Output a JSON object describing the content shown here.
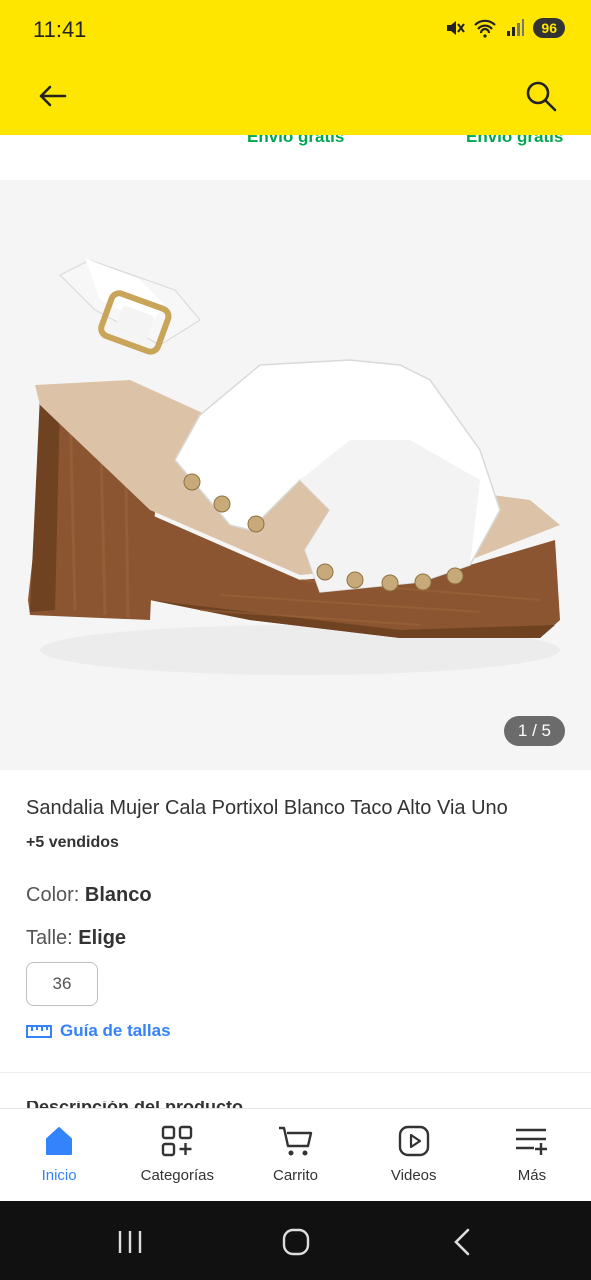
{
  "status_bar": {
    "time": "11:41",
    "battery": "96"
  },
  "header": {
    "back_icon": "arrow-left-icon",
    "search_icon": "search-icon"
  },
  "shipping_peek": [
    "Envío gratis",
    "Envío gratis"
  ],
  "gallery": {
    "counter": "1 / 5"
  },
  "product": {
    "title": "Sandalia Mujer Cala Portixol  Blanco Taco Alto Via Uno",
    "sold": "+5 vendidos",
    "color_label": "Color: ",
    "color_value": "Blanco",
    "size_label": "Talle: ",
    "size_value": "Elige",
    "size_option": "36",
    "size_guide": "Guía de tallas"
  },
  "peek": {
    "section_partial": "Descripción del producto"
  },
  "bottom_nav": [
    {
      "label": "Inicio",
      "icon": "home-icon",
      "active": true
    },
    {
      "label": "Categorías",
      "icon": "categories-icon",
      "active": false
    },
    {
      "label": "Carrito",
      "icon": "cart-icon",
      "active": false
    },
    {
      "label": "Videos",
      "icon": "video-icon",
      "active": false
    },
    {
      "label": "Más",
      "icon": "more-menu-icon",
      "active": false
    }
  ],
  "colors": {
    "header": "#ffe600",
    "accent": "#3483fa",
    "shipping": "#00a650"
  }
}
